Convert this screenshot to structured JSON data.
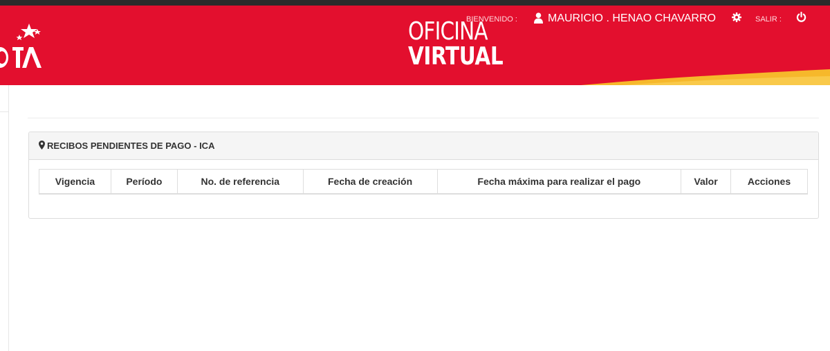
{
  "header": {
    "logo_alt": "Bogotá logo",
    "brand": {
      "line1": "OFICINA",
      "line2": "VIRTUAL"
    },
    "welcome_label": "BIENVENIDO :",
    "user_name": "MAURICIO . HENAO CHAVARRO",
    "logout_label": "SALIR :",
    "icons": {
      "user": "user-icon",
      "settings": "gear-icon",
      "logout": "power-icon"
    }
  },
  "panel": {
    "icon": "map-marker-icon",
    "title": "RECIBOS PENDIENTES DE PAGO - ICA",
    "table": {
      "columns": [
        "Vigencia",
        "Período",
        "No. de referencia",
        "Fecha de creación",
        "Fecha máxima para realizar el pago",
        "Valor",
        "Acciones"
      ],
      "rows": []
    }
  },
  "colors": {
    "header_red": "#e30f2e",
    "accent_gold": "#f6b82b",
    "top_strip": "#2b2b2b",
    "panel_heading_bg": "#f5f5f5",
    "text_dark": "#333333"
  }
}
